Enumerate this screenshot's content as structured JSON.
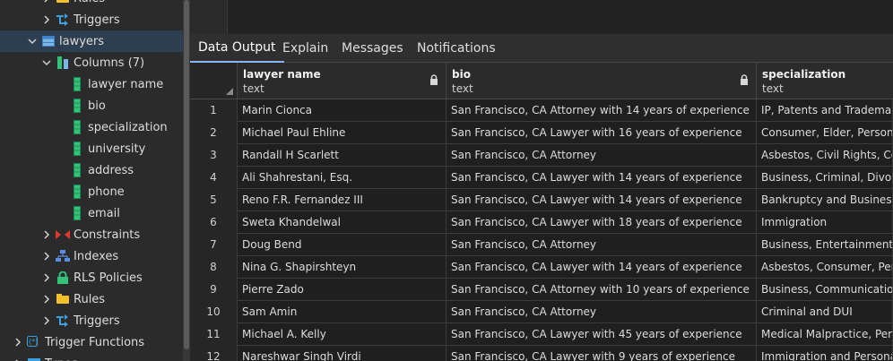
{
  "sidebar": {
    "items": [
      {
        "label": "Rules",
        "icon": "rules-icon",
        "chev": ">"
      },
      {
        "label": "Triggers",
        "icon": "triggers-icon",
        "chev": ">"
      },
      {
        "label": "lawyers",
        "icon": "table-icon",
        "chev": "v"
      },
      {
        "label": "Columns (7)",
        "icon": "columns-icon",
        "chev": "v"
      },
      {
        "label": "lawyer name",
        "icon": "column-icon",
        "chev": ""
      },
      {
        "label": "bio",
        "icon": "column-icon",
        "chev": ""
      },
      {
        "label": "specialization",
        "icon": "column-icon",
        "chev": ""
      },
      {
        "label": "university",
        "icon": "column-icon",
        "chev": ""
      },
      {
        "label": "address",
        "icon": "column-icon",
        "chev": ""
      },
      {
        "label": "phone",
        "icon": "column-icon",
        "chev": ""
      },
      {
        "label": "email",
        "icon": "column-icon",
        "chev": ""
      },
      {
        "label": "Constraints",
        "icon": "constraints-icon",
        "chev": ">"
      },
      {
        "label": "Indexes",
        "icon": "indexes-icon",
        "chev": ">"
      },
      {
        "label": "RLS Policies",
        "icon": "rls-policies-icon",
        "chev": ">"
      },
      {
        "label": "Rules",
        "icon": "rules-icon",
        "chev": ">"
      },
      {
        "label": "Triggers",
        "icon": "triggers-icon",
        "chev": ">"
      },
      {
        "label": "Trigger Functions",
        "icon": "trigger-functions-icon",
        "chev": ">"
      },
      {
        "label": "Types",
        "icon": "types-icon",
        "chev": ">"
      }
    ]
  },
  "tabs": [
    {
      "label": "Data Output"
    },
    {
      "label": "Explain"
    },
    {
      "label": "Messages"
    },
    {
      "label": "Notifications"
    }
  ],
  "grid": {
    "columns": [
      {
        "name": "lawyer name",
        "type": "text"
      },
      {
        "name": "bio",
        "type": "text"
      },
      {
        "name": "specialization",
        "type": "text"
      }
    ],
    "rows": [
      {
        "n": "1",
        "name": "Marin Cionca",
        "bio": "San Francisco, CA Attorney with 14 years of experience",
        "spec": "IP, Patents and Trademarks"
      },
      {
        "n": "2",
        "name": "Michael Paul Ehline",
        "bio": "San Francisco, CA Lawyer with 16 years of experience",
        "spec": "Consumer, Elder, Personal Injury"
      },
      {
        "n": "3",
        "name": "Randall H Scarlett",
        "bio": "San Francisco, CA Attorney",
        "spec": "Asbestos, Civil Rights, Consumer"
      },
      {
        "n": "4",
        "name": "Ali Shahrestani, Esq.",
        "bio": "San Francisco, CA Lawyer with 14 years of experience",
        "spec": "Business, Criminal, Divorce and"
      },
      {
        "n": "5",
        "name": "Reno F.R. Fernandez III",
        "bio": "San Francisco, CA Lawyer with 14 years of experience",
        "spec": "Bankruptcy and Business"
      },
      {
        "n": "6",
        "name": "Sweta Khandelwal",
        "bio": "San Francisco, CA Lawyer with 18 years of experience",
        "spec": "Immigration"
      },
      {
        "n": "7",
        "name": "Doug Bend",
        "bio": "San Francisco, CA Attorney",
        "spec": "Business, Entertainment & Sports"
      },
      {
        "n": "8",
        "name": "Nina G. Shapirshteyn",
        "bio": "San Francisco, CA Lawyer with 14 years of experience",
        "spec": "Asbestos, Consumer, Personal"
      },
      {
        "n": "9",
        "name": "Pierre Zado",
        "bio": "San Francisco, CA Attorney with 10 years of experience",
        "spec": "Business, Communications"
      },
      {
        "n": "10",
        "name": "Sam Amin",
        "bio": "San Francisco, CA Attorney",
        "spec": "Criminal and DUI"
      },
      {
        "n": "11",
        "name": "Michael A. Kelly",
        "bio": "San Francisco, CA Lawyer with 45 years of experience",
        "spec": "Medical Malpractice, Personal"
      },
      {
        "n": "12",
        "name": "Nareshwar Singh Virdi",
        "bio": "San Francisco, CA Lawyer with 9 years of experience",
        "spec": "Immigration and Personal Injury"
      }
    ]
  },
  "colors": {
    "accent": "#8ab4f8",
    "selected": "#2c3e4f"
  }
}
